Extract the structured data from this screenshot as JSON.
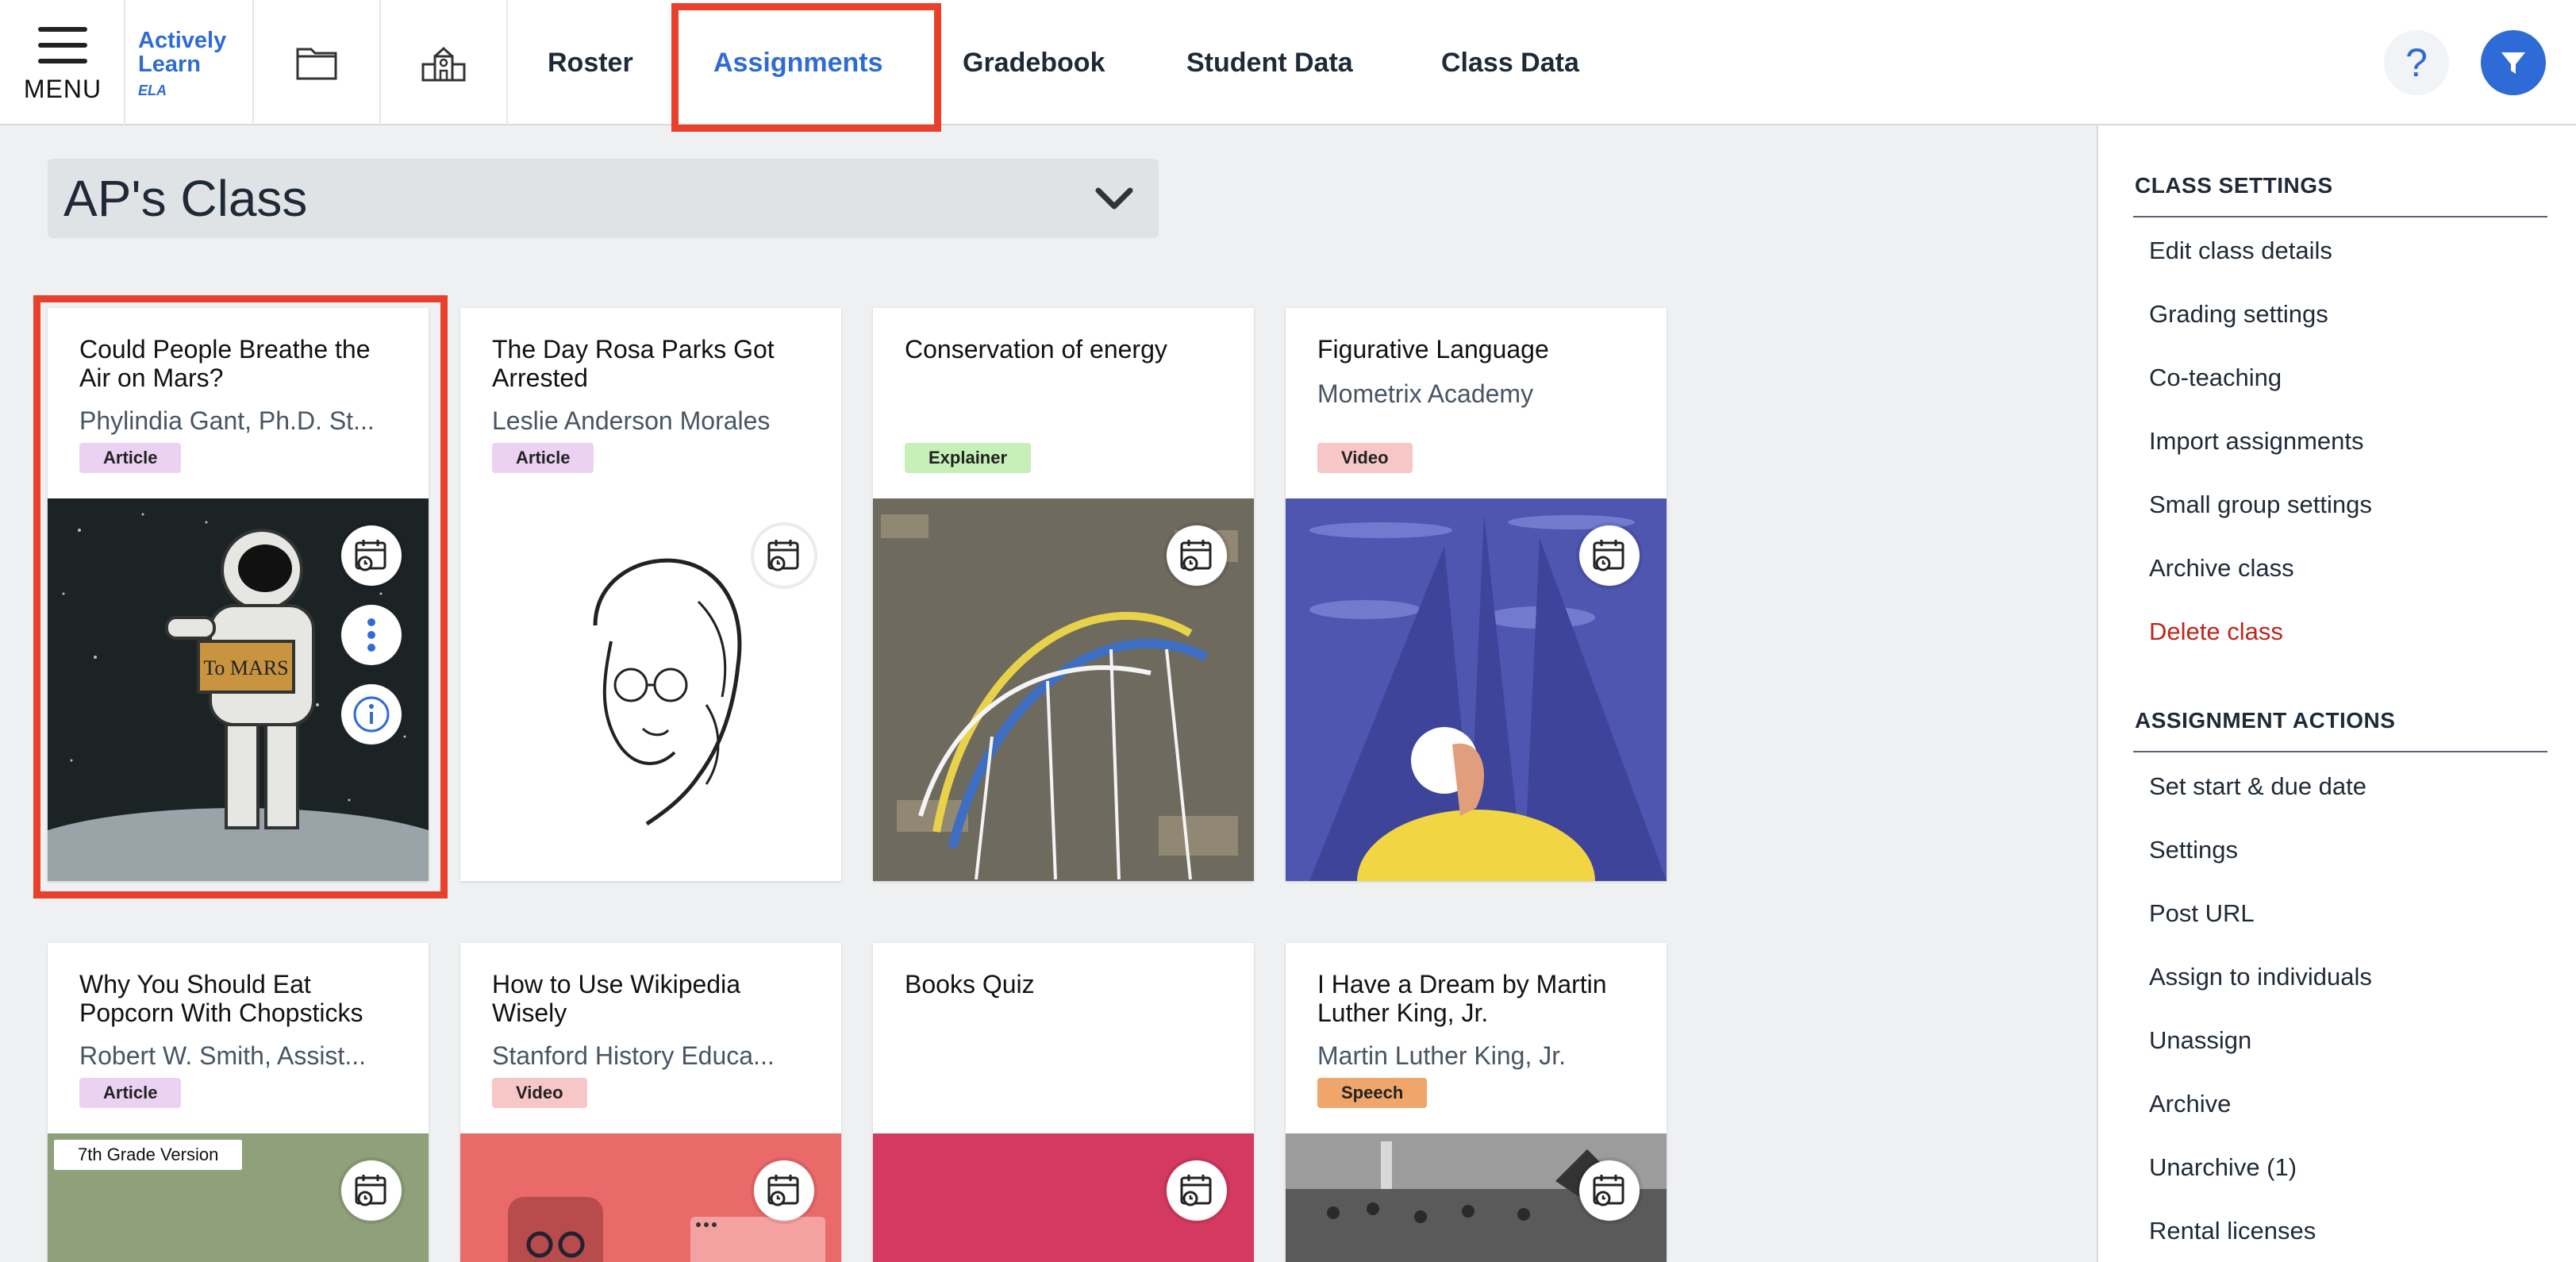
{
  "topbar": {
    "menu_label": "MENU",
    "logo": {
      "line1": "Actively",
      "line2": "Learn",
      "sub": "ELA"
    },
    "tabs": [
      {
        "label": "Roster"
      },
      {
        "label": "Assignments",
        "active": true
      },
      {
        "label": "Gradebook"
      },
      {
        "label": "Student Data"
      },
      {
        "label": "Class Data"
      }
    ],
    "help_label": "?"
  },
  "class_selector": {
    "value": "AP's Class"
  },
  "cards": [
    {
      "title": "Could People Breathe the Air on Mars?",
      "author": "Phylindia Gant, Ph.D. St...",
      "type": "Article",
      "image_sign": "To MARS"
    },
    {
      "title": "The Day Rosa Parks Got Arrested",
      "author": "Leslie Anderson Morales",
      "type": "Article"
    },
    {
      "title": "Conservation of energy",
      "author": "",
      "type": "Explainer"
    },
    {
      "title": "Figurative Language",
      "author": "Mometrix Academy",
      "type": "Video"
    },
    {
      "title": "Why You Should Eat Popcorn With Chopsticks",
      "author": "Robert W. Smith, Assist...",
      "type": "Article",
      "grade_tag": "7th Grade Version"
    },
    {
      "title": "How to Use Wikipedia Wisely",
      "author": "Stanford History Educa...",
      "type": "Video"
    },
    {
      "title": "Books Quiz",
      "author": "",
      "type": ""
    },
    {
      "title": "I Have a Dream by Martin Luther King, Jr.",
      "author": "Martin Luther King, Jr.",
      "type": "Speech"
    }
  ],
  "badge_colors": {
    "Article": "#ecd2f2",
    "Explainer": "#c7efb8",
    "Video": "#f7c6c6",
    "Speech": "#f0a66a"
  },
  "right_panel": {
    "class_settings_header": "CLASS SETTINGS",
    "class_settings": [
      "Edit class details",
      "Grading settings",
      "Co-teaching",
      "Import assignments",
      "Small group settings",
      "Archive class",
      "Delete class"
    ],
    "assignment_actions_header": "ASSIGNMENT ACTIONS",
    "assignment_actions": [
      "Set start & due date",
      "Settings",
      "Post URL",
      "Assign to individuals",
      "Unassign",
      "Archive",
      "Unarchive (1)",
      "Rental licenses"
    ]
  },
  "colors": {
    "accent": "#2f6bd6",
    "highlight": "#e8402a",
    "danger": "#c0251b"
  }
}
